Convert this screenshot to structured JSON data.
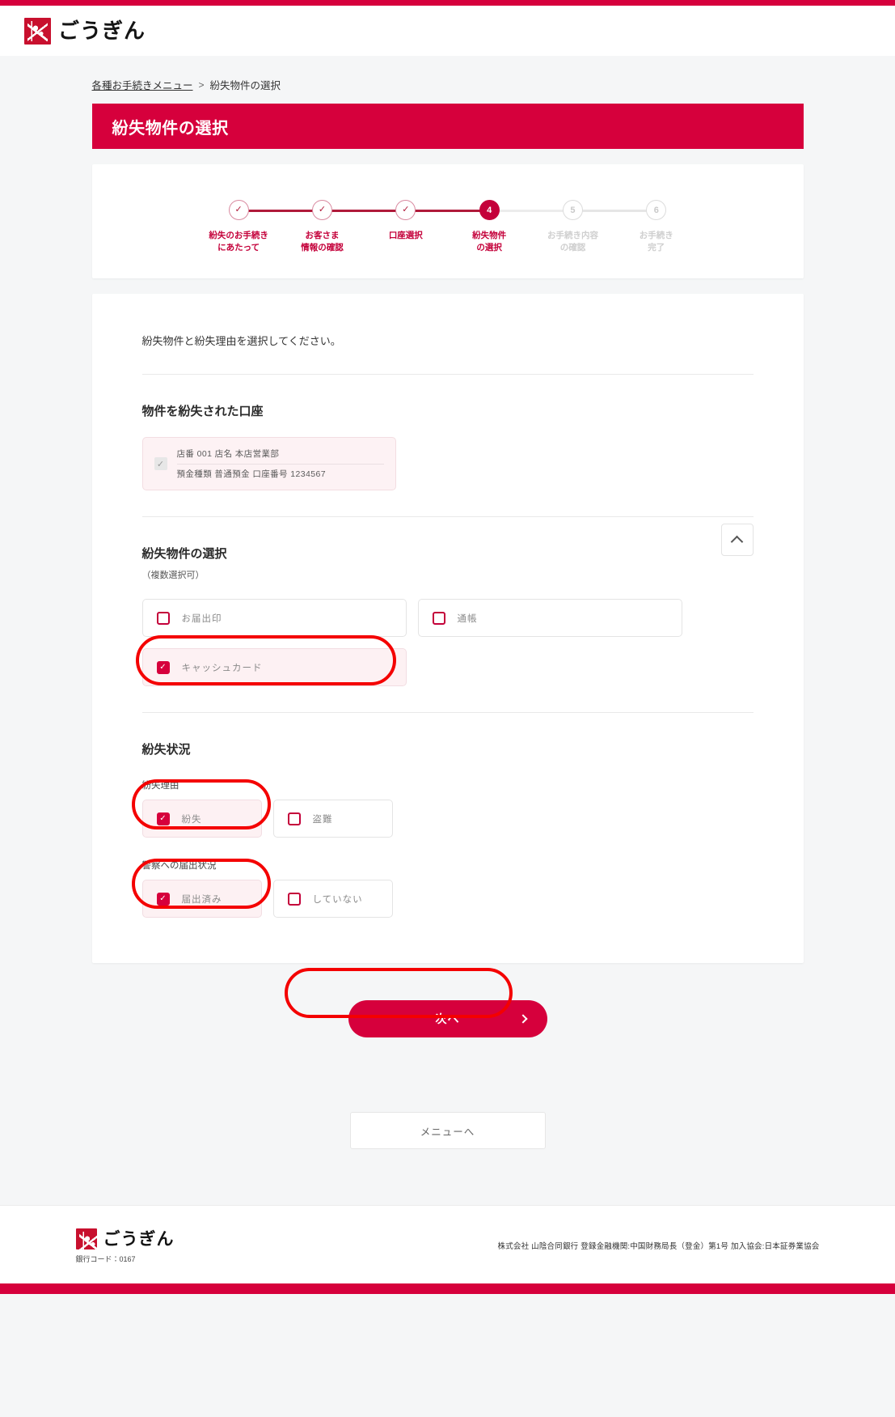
{
  "header": {
    "brand": "ごうぎん",
    "logo_icon": "gogin-logo-icon"
  },
  "breadcrumb": {
    "home": "各種お手続きメニュー",
    "separator": ">",
    "current": "紛失物件の選択"
  },
  "page_title": "紛失物件の選択",
  "stepper": {
    "steps": [
      {
        "num": "1",
        "label": "紛失のお手続き\nにあたって",
        "state": "done",
        "mark": "✓"
      },
      {
        "num": "2",
        "label": "お客さま\n情報の確認",
        "state": "done",
        "mark": "✓"
      },
      {
        "num": "3",
        "label": "口座選択",
        "state": "done",
        "mark": "✓"
      },
      {
        "num": "4",
        "label": "紛失物件\nの選択",
        "state": "current",
        "mark": "4"
      },
      {
        "num": "5",
        "label": "お手続き内容\nの確認",
        "state": "todo",
        "mark": "5"
      },
      {
        "num": "6",
        "label": "お手続き\n完了",
        "state": "todo",
        "mark": "6"
      }
    ]
  },
  "form": {
    "lead": "紛失物件と紛失理由を選択してください。",
    "account_section": {
      "title": "物件を紛失された口座",
      "check_icon": "checkmark-icon",
      "line1": "店番  001   店名  本店営業部",
      "line2": "預金種類  普通預金   口座番号  1234567"
    },
    "item_section": {
      "title": "紛失物件の選択",
      "subtitle": "（複数選択可）",
      "collapse_icon": "chevron-up-icon",
      "options": [
        {
          "label": "お届出印",
          "checked": false
        },
        {
          "label": "通帳",
          "checked": false
        },
        {
          "label": "キャッシュカード",
          "checked": true
        }
      ]
    },
    "status_section": {
      "title": "紛失状況",
      "reason_label": "紛失理由",
      "reason_options": [
        {
          "label": "紛失",
          "checked": true
        },
        {
          "label": "盗難",
          "checked": false
        }
      ],
      "police_label": "警察への届出状況",
      "police_options": [
        {
          "label": "届出済み",
          "checked": true
        },
        {
          "label": "していない",
          "checked": false
        }
      ]
    }
  },
  "actions": {
    "next_label": "次へ",
    "next_arrow_icon": "chevron-right-icon",
    "menu_label": "メニューへ"
  },
  "footer": {
    "brand": "ごうぎん",
    "bank_code": "銀行コード：0167",
    "legal": "株式会社 山陰合同銀行 登録金融機関:中国財務局長（登金）第1号 加入協会:日本証券業協会"
  },
  "colors": {
    "brand_red": "#d6003c",
    "accent_red": "#c4003a",
    "annotation": "#f40000"
  }
}
